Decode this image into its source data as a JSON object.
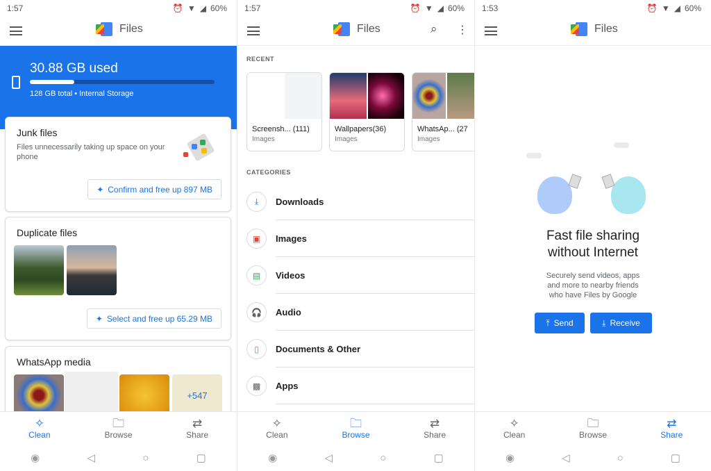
{
  "status_bar": {
    "battery": "60%"
  },
  "app": {
    "title": "Files"
  },
  "clean_screen": {
    "time": "1:57",
    "storage": {
      "used_label": "30.88 GB used",
      "detail": "128 GB total • Internal Storage",
      "used_fraction": 0.24
    },
    "junk": {
      "title": "Junk files",
      "description": "Files unnecessarily taking up space on your phone",
      "button": "Confirm and free up 897 MB"
    },
    "duplicates": {
      "title": "Duplicate files",
      "button": "Select and free up 65.29 MB"
    },
    "whatsapp": {
      "title": "WhatsApp media",
      "more_count": "+547"
    }
  },
  "browse_screen": {
    "time": "1:57",
    "recent_header": "RECENT",
    "recent": [
      {
        "title": "Screensh...",
        "count": "(111)",
        "type": "Images"
      },
      {
        "title": "Wallpapers",
        "count": "(36)",
        "type": "Images"
      },
      {
        "title": "WhatsAp...",
        "count": "(27",
        "type": "Images"
      }
    ],
    "categories_header": "CATEGORIES",
    "categories": [
      {
        "label": "Downloads",
        "icon": "download-icon",
        "color": "#1a73e8"
      },
      {
        "label": "Images",
        "icon": "image-icon",
        "color": "#ea4335"
      },
      {
        "label": "Videos",
        "icon": "video-icon",
        "color": "#34a853"
      },
      {
        "label": "Audio",
        "icon": "headphones-icon",
        "color": "#a142f4"
      },
      {
        "label": "Documents & Other",
        "icon": "document-icon",
        "color": "#12b5cb"
      },
      {
        "label": "Apps",
        "icon": "android-icon",
        "color": "#5f6368"
      }
    ]
  },
  "share_screen": {
    "time": "1:53",
    "title_line1": "Fast file sharing",
    "title_line2": "without Internet",
    "description_line1": "Securely send videos, apps",
    "description_line2": "and more to nearby friends",
    "description_line3": "who have Files by Google",
    "send": "Send",
    "receive": "Receive"
  },
  "bottom_nav": [
    {
      "label": "Clean"
    },
    {
      "label": "Browse"
    },
    {
      "label": "Share"
    }
  ],
  "colors": {
    "accent": "#1a73e8"
  }
}
